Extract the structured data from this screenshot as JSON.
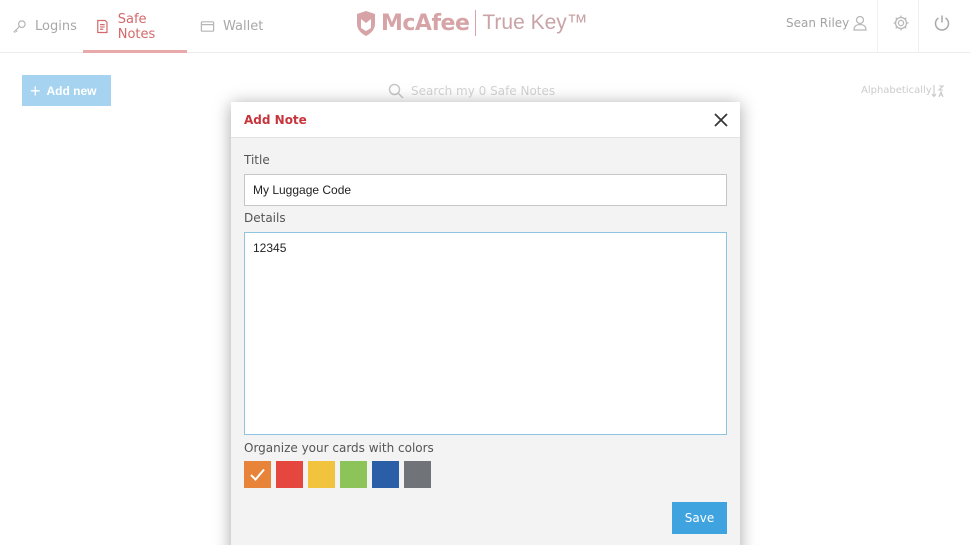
{
  "nav": {
    "tabs": [
      {
        "label": "Logins",
        "icon": "key-icon"
      },
      {
        "label": "Safe Notes",
        "icon": "note-icon",
        "active": true
      },
      {
        "label": "Wallet",
        "icon": "wallet-icon"
      }
    ]
  },
  "brand": {
    "name": "McAfee",
    "product": "True Key™"
  },
  "user": {
    "name": "Sean Riley"
  },
  "toolbar": {
    "add_new_label": "Add new",
    "search_placeholder": "Search my 0 Safe Notes",
    "sort_label": "Alphabetically"
  },
  "modal": {
    "title": "Add Note",
    "title_label": "Title",
    "title_value": "My Luggage Code",
    "details_label": "Details",
    "details_value": "12345",
    "colors_label": "Organize your cards with colors",
    "save_label": "Save",
    "swatches": [
      {
        "name": "orange",
        "color": "#e8833a",
        "selected": true
      },
      {
        "name": "red",
        "color": "#e5473f",
        "selected": false
      },
      {
        "name": "yellow",
        "color": "#f2c33c",
        "selected": false
      },
      {
        "name": "green",
        "color": "#8dc45a",
        "selected": false
      },
      {
        "name": "blue",
        "color": "#2a5fa8",
        "selected": false
      },
      {
        "name": "gray",
        "color": "#707479",
        "selected": false
      }
    ]
  },
  "colors": {
    "accent_red": "#c8343c",
    "save_blue": "#3fa3e0",
    "active_tab": "#d3696a"
  }
}
